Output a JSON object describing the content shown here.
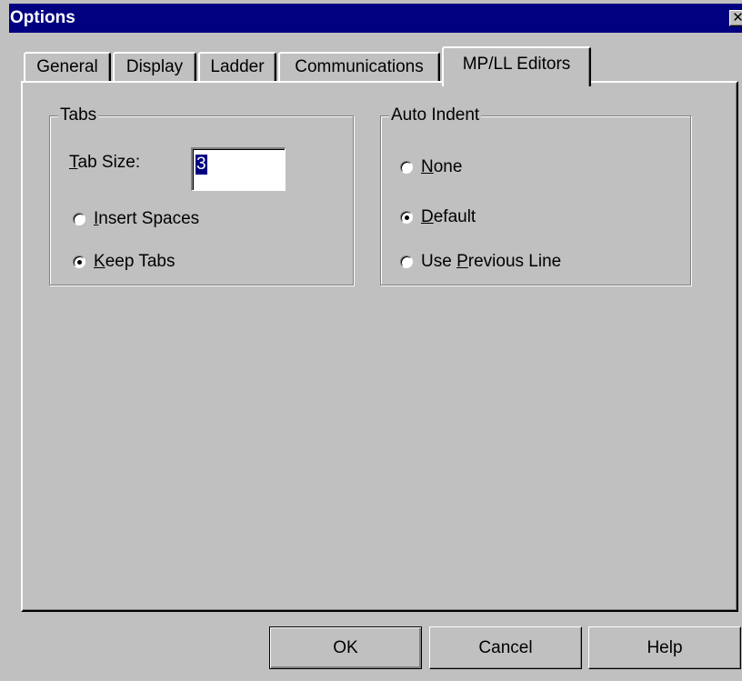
{
  "window": {
    "title": "Options",
    "close_glyph": "✕"
  },
  "tabs": [
    {
      "label": "General",
      "active": false
    },
    {
      "label": "Display",
      "active": false
    },
    {
      "label": "Ladder",
      "active": false
    },
    {
      "label": "Communications",
      "active": false
    },
    {
      "label": "MP/LL Editors",
      "active": true
    }
  ],
  "tabs_group": {
    "title": "Tabs",
    "tab_size_label_prefix": "",
    "tab_size_label_mnemonic": "T",
    "tab_size_label_rest": "ab Size:",
    "tab_size_value": "3",
    "options": [
      {
        "mnemonic": "I",
        "rest": "nsert Spaces",
        "selected": false
      },
      {
        "mnemonic": "K",
        "rest": "eep Tabs",
        "selected": true
      }
    ]
  },
  "auto_indent_group": {
    "title": "Auto Indent",
    "options": [
      {
        "prefix": "",
        "mnemonic": "N",
        "rest": "one",
        "selected": false
      },
      {
        "prefix": "",
        "mnemonic": "D",
        "rest": "efault",
        "selected": true
      },
      {
        "prefix": "Use ",
        "mnemonic": "P",
        "rest": "revious Line",
        "selected": false
      }
    ]
  },
  "buttons": {
    "ok": "OK",
    "cancel": "Cancel",
    "help": "Help"
  },
  "colors": {
    "titlebar": "#000080",
    "face": "#c0c0c0",
    "selection": "#000080"
  }
}
